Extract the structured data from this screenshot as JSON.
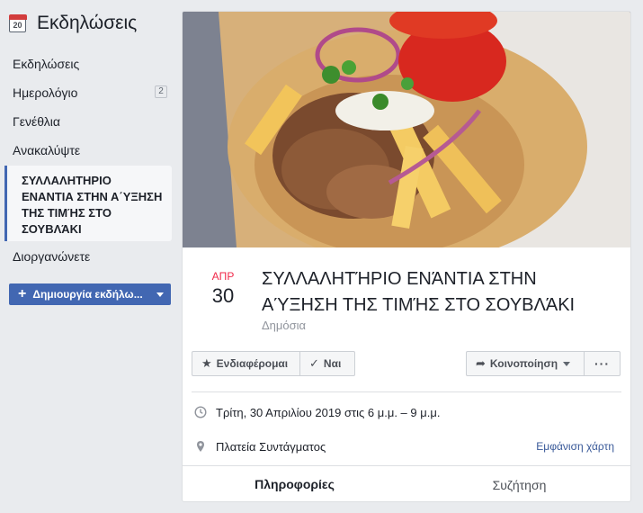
{
  "sidebar": {
    "title": "Εκδηλώσεις",
    "calendar_icon_day": "20",
    "items": [
      {
        "label": "Εκδηλώσεις"
      },
      {
        "label": "Ημερολόγιο",
        "badge": "2"
      },
      {
        "label": "Γενέθλια"
      },
      {
        "label": "Ανακαλύψτε"
      }
    ],
    "active_event": "ΣΥΛΛΑΛΗΤΗΡΙΟ ΕΝΑΝΤΙΑ ΣΤΗΝ Α΄ΥΞΗΣΗ ΤΗΣ ΤΙΜΉΣ ΣΤΟ ΣΟΥΒΛΆΚΙ",
    "organize_label": "Διοργανώνετε",
    "create_button": "Δημιουργία εκδήλω..."
  },
  "event": {
    "month": "ΑΠΡ",
    "day": "30",
    "title": "ΣΥΛΛΑΛΗΤΉΡΙΟ ΕΝΆΝΤΙΑ ΣΤΗΝ ΑΎΞΗΣΗ ΤΗΣ ΤΙΜΉΣ ΣΤΟ ΣΟΥΒΛΆΚΙ",
    "privacy": "Δημόσια",
    "buttons": {
      "interested": "Ενδιαφέρομαι",
      "going": "Ναι",
      "share": "Κοινοποίηση",
      "more": "···"
    },
    "datetime": "Τρίτη, 30 Απριλίου 2019 στις 6 μ.μ. – 9 μ.μ.",
    "location": "Πλατεία Συντάγματος",
    "map_link": "Εμφάνιση χάρτη",
    "tabs": {
      "info": "Πληροφορίες",
      "discussion": "Συζήτηση"
    }
  },
  "colors": {
    "accent": "#4267b2",
    "date_month": "#f02849",
    "link": "#385898"
  }
}
